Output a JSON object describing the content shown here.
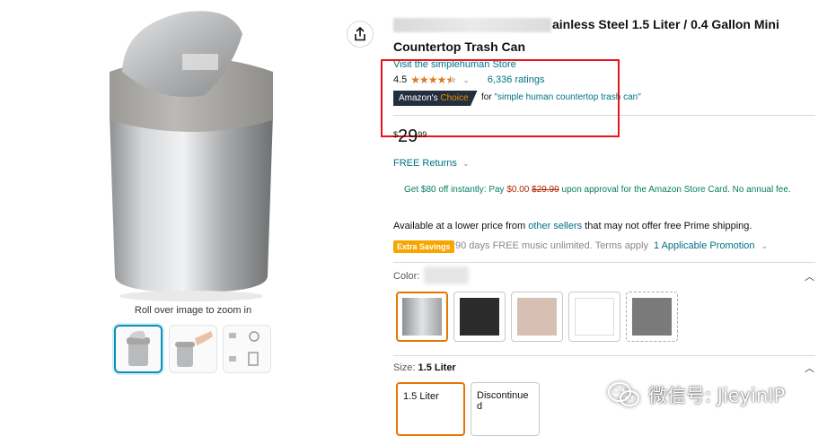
{
  "gallery": {
    "zoom_hint": "Roll over image to zoom in",
    "thumbnail_count": 3
  },
  "title": {
    "line1": "ainless Steel 1.5 Liter / 0.4 Gallon Mini",
    "line2": "Countertop Trash Can"
  },
  "store_link": "Visit the simplehuman Store",
  "rating": {
    "value": "4.5",
    "stars": 4.5,
    "count": "6,336 ratings"
  },
  "badge": {
    "part1": "Amazon's ",
    "part2": "Choice",
    "for_prefix": "for ",
    "query": "\"simple human countertop trash can\""
  },
  "price": {
    "symbol": "$",
    "whole": "29",
    "fraction": "99"
  },
  "free_returns": "FREE Returns",
  "card_offer": {
    "prefix": "Get $80 off instantly: Pay ",
    "new_price": "$0.00",
    "old_price": "$29.99",
    "suffix": " upon approval for the Amazon Store Card. No annual fee."
  },
  "lower_price": {
    "prefix": "Available at a lower price from ",
    "link": "other sellers",
    "suffix": " that may not offer free Prime shipping."
  },
  "extra_savings": {
    "badge": "Extra Savings",
    "text": "90 days FREE music unlimited. Terms apply",
    "promo": "1 Applicable Promotion"
  },
  "color": {
    "label": "Color:",
    "swatches": [
      {
        "name": "silver",
        "color": "#bdbdbd"
      },
      {
        "name": "black",
        "color": "#2b2b2b"
      },
      {
        "name": "rose",
        "color": "#d8bfb4"
      },
      {
        "name": "white",
        "color": "#ffffff"
      },
      {
        "name": "grey",
        "color": "#7a7a7a"
      }
    ]
  },
  "size": {
    "label": "Size:",
    "value": "1.5 Liter",
    "options": [
      "1.5 Liter",
      "Discontinued"
    ]
  },
  "watermark": "微信号: JieyinIP",
  "colors": {
    "link": "#007185",
    "price_red": "#b12704",
    "star_orange": "#de7921",
    "annotation_red": "#e8131b",
    "selected_orange": "#e77600"
  }
}
